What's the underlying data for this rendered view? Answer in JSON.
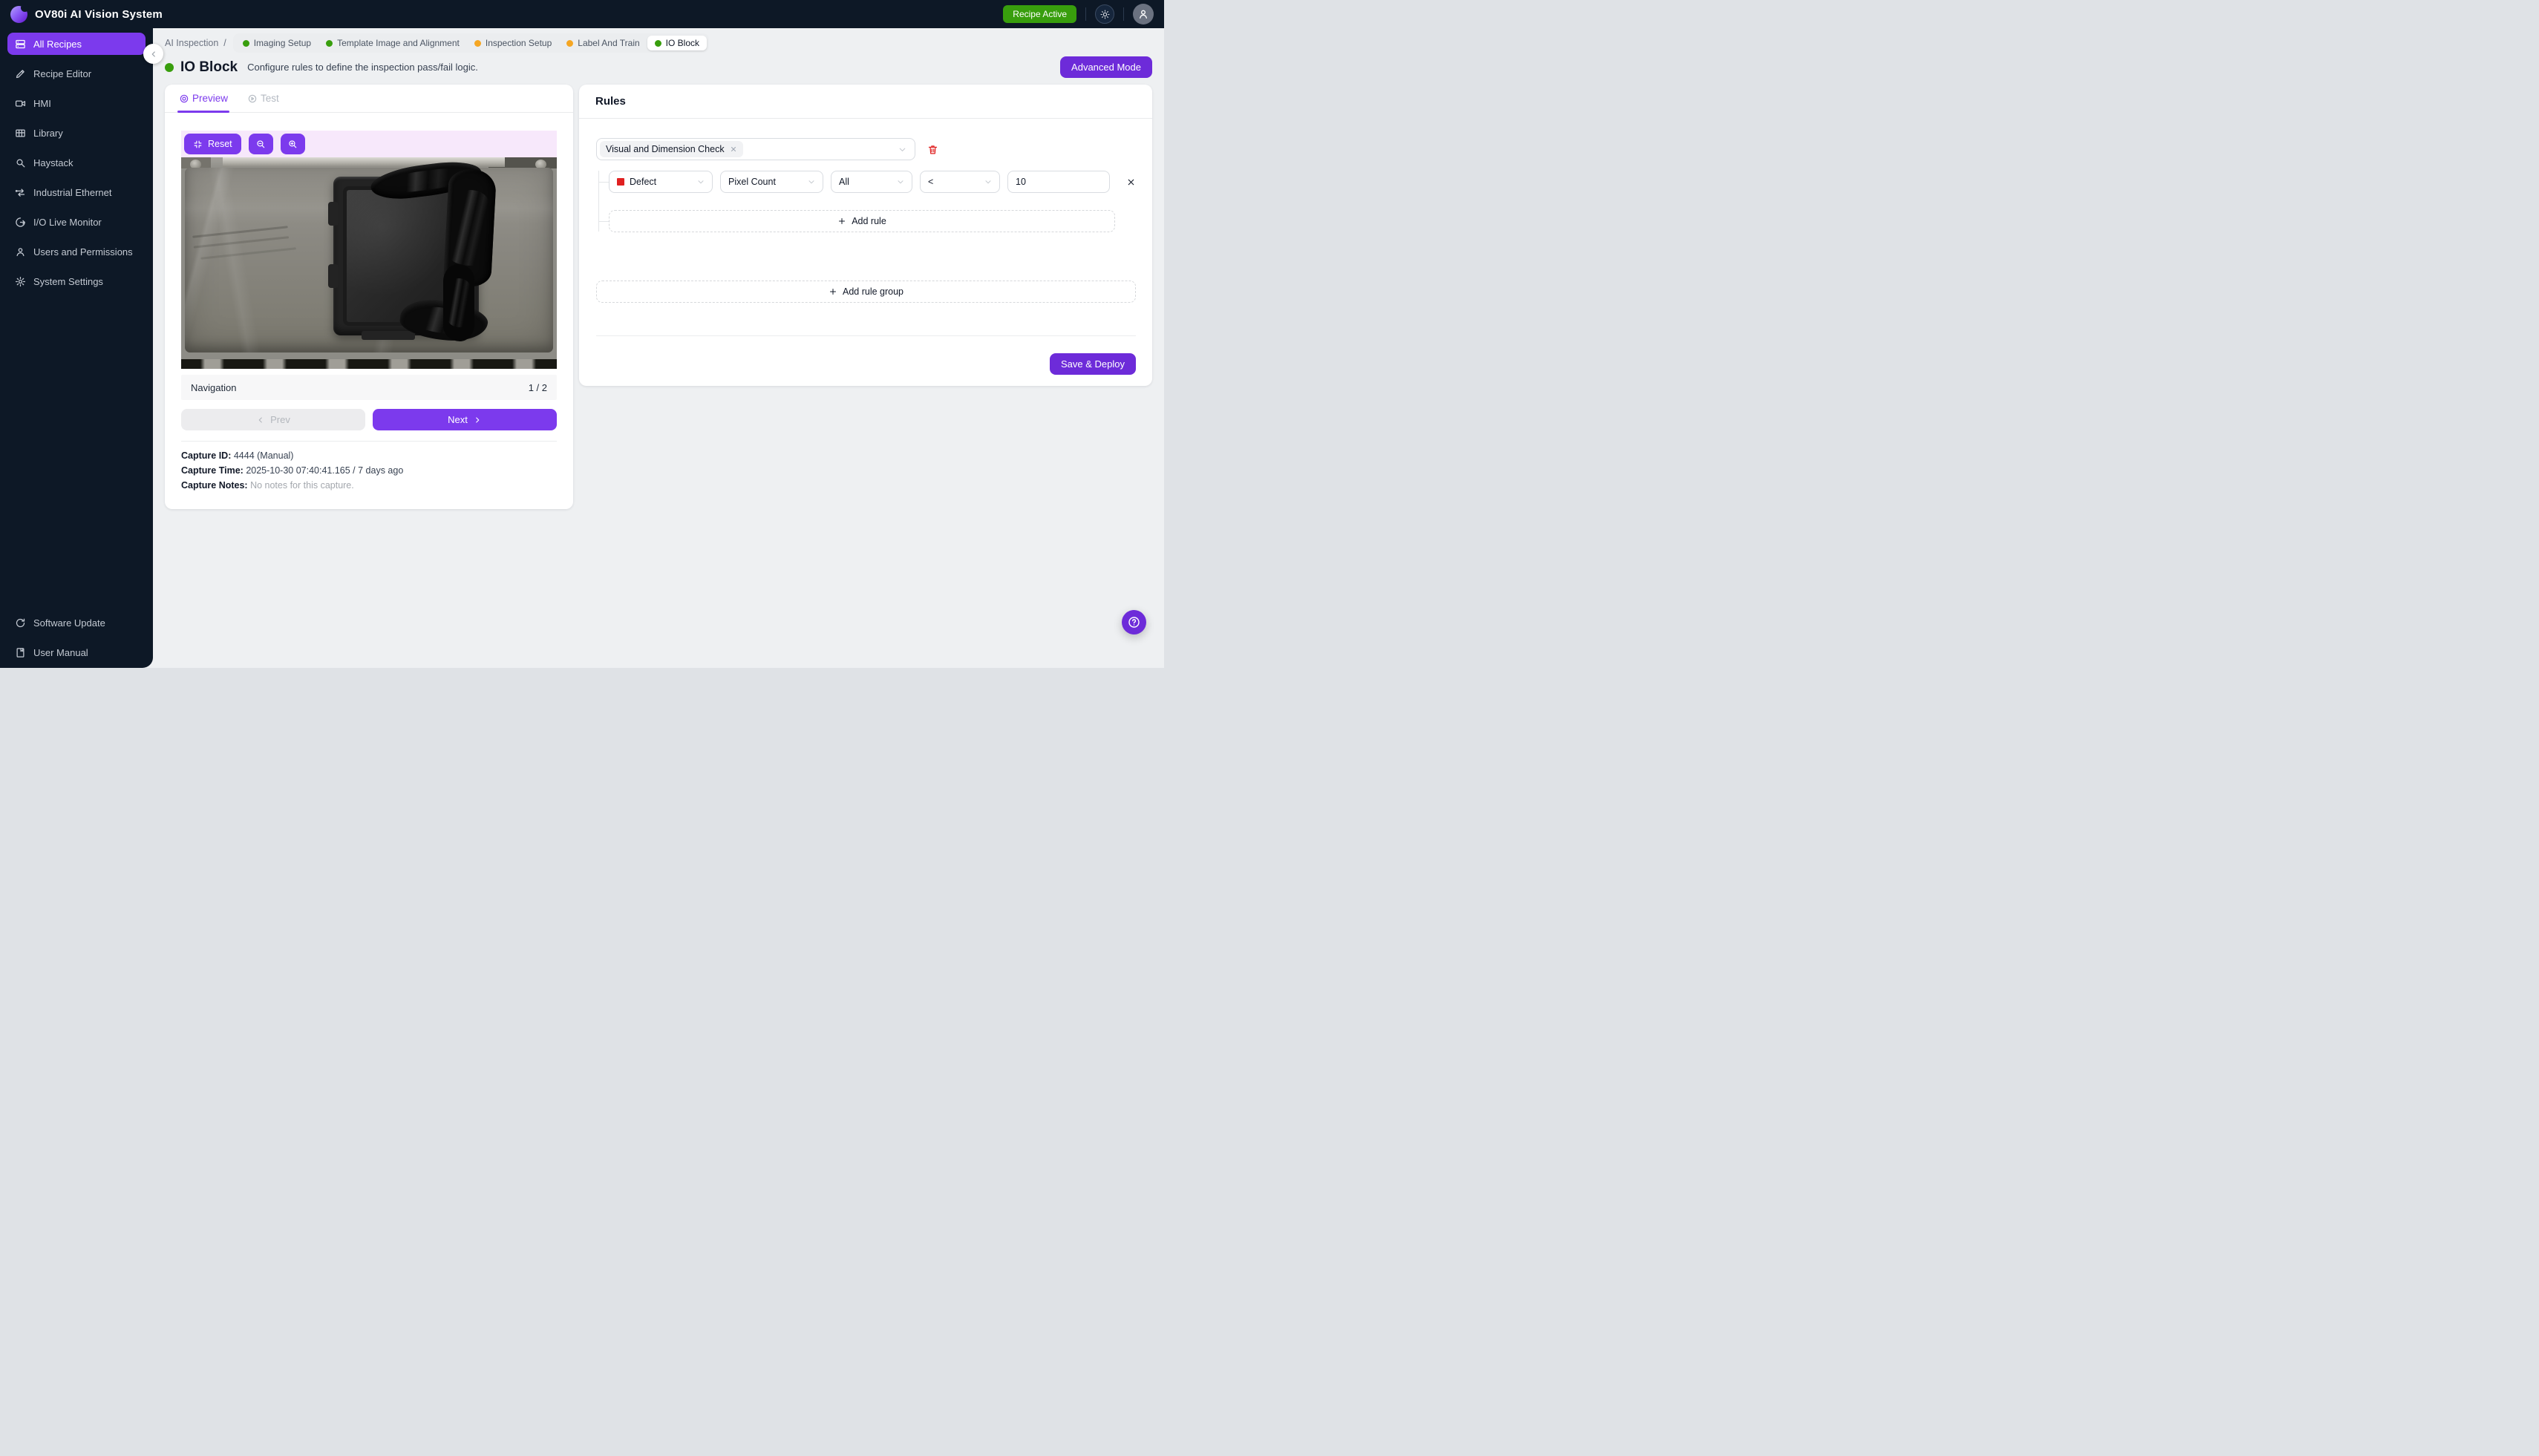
{
  "topbar": {
    "title": "OV80i AI Vision System",
    "recipe_status": "Recipe Active"
  },
  "sidebar": {
    "items": [
      {
        "label": "All Recipes",
        "icon": "recipes-icon",
        "active": true
      },
      {
        "label": "Recipe Editor",
        "icon": "pencil-icon"
      },
      {
        "label": "HMI",
        "icon": "camera-icon"
      },
      {
        "label": "Library",
        "icon": "table-icon"
      },
      {
        "label": "Haystack",
        "icon": "search-icon"
      },
      {
        "label": "Industrial Ethernet",
        "icon": "swap-arrows-icon"
      },
      {
        "label": "I/O Live Monitor",
        "icon": "circle-arrow-icon"
      },
      {
        "label": "Users and Permissions",
        "icon": "user-icon"
      },
      {
        "label": "System Settings",
        "icon": "gear-icon"
      }
    ],
    "footer_items": [
      {
        "label": "Software Update",
        "icon": "refresh-icon"
      },
      {
        "label": "User Manual",
        "icon": "book-icon"
      }
    ]
  },
  "breadcrumb": {
    "section": "AI Inspection",
    "separator": "/",
    "steps": [
      {
        "label": "Imaging Setup",
        "status": "green"
      },
      {
        "label": "Template Image and Alignment",
        "status": "green"
      },
      {
        "label": "Inspection Setup",
        "status": "orange"
      },
      {
        "label": "Label And Train",
        "status": "orange"
      },
      {
        "label": "IO Block",
        "status": "green",
        "active": true
      }
    ]
  },
  "page_header": {
    "title": "IO Block",
    "subtitle": "Configure rules to define the inspection pass/fail logic.",
    "advanced_mode_label": "Advanced Mode"
  },
  "preview_panel": {
    "tabs": [
      {
        "label": "Preview",
        "icon": "target-icon",
        "active": true
      },
      {
        "label": "Test",
        "icon": "play-circle-icon",
        "active": false
      }
    ],
    "toolbar": {
      "reset_label": "Reset"
    },
    "navigation": {
      "label": "Navigation",
      "position": "1 / 2",
      "prev_label": "Prev",
      "next_label": "Next"
    },
    "capture": {
      "id_label": "Capture ID:",
      "id_value": "4444 (Manual)",
      "time_label": "Capture Time:",
      "time_value": "2025-10-30 07:40:41.165 / 7 days ago",
      "notes_label": "Capture Notes:",
      "notes_value": "No notes for this capture."
    }
  },
  "rules_panel": {
    "title": "Rules",
    "group_select": {
      "tag": "Visual and Dimension Check"
    },
    "rule": {
      "class_value": "Defect",
      "feature_value": "Pixel Count",
      "scope_value": "All",
      "operator_value": "<",
      "threshold_value": "10"
    },
    "add_rule_label": "Add rule",
    "add_rule_group_label": "Add rule group",
    "save_deploy_label": "Save & Deploy"
  },
  "colors": {
    "accent": "#7c3aed",
    "accent_deep": "#6d2bd9",
    "green": "#389e0d",
    "dot_orange": "#f5a623",
    "danger_red": "#e02020",
    "sidebar_bg": "#0d1826",
    "toolbar_tint": "#f7e8fb"
  }
}
